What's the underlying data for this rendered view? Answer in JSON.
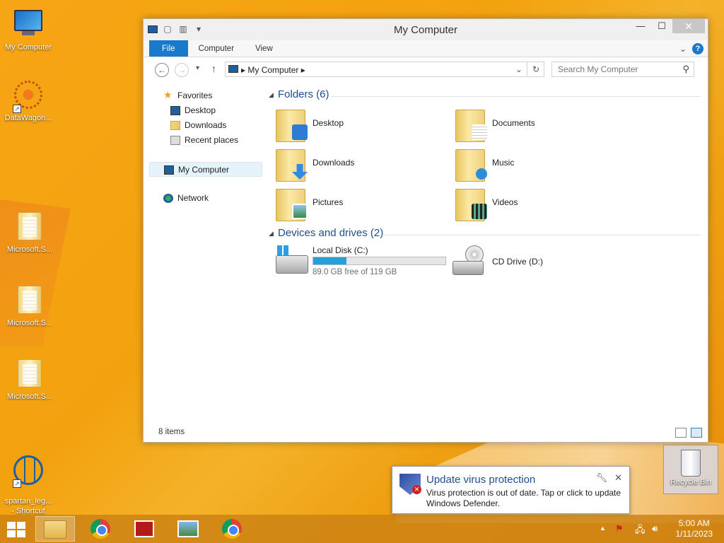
{
  "desktop": {
    "icons": [
      {
        "label": "My Computer"
      },
      {
        "label": "DataWagon..."
      },
      {
        "label": "Microsoft.S..."
      },
      {
        "label": "Microsoft.S..."
      },
      {
        "label": "Microsoft.S..."
      },
      {
        "label": "spartan_leg...\n- Shortcut"
      }
    ],
    "recycle_bin": "Recycle Bin"
  },
  "window": {
    "title": "My Computer",
    "buttons": {
      "minimize": "—",
      "maximize": "☐",
      "close": "✕"
    },
    "ribbon": {
      "file": "File",
      "tabs": [
        "Computer",
        "View"
      ]
    },
    "address": {
      "crumb": "My Computer"
    },
    "search": {
      "placeholder": "Search My Computer"
    },
    "nav": {
      "favorites": "Favorites",
      "fav_items": [
        "Desktop",
        "Downloads",
        "Recent places"
      ],
      "this_pc": "My Computer",
      "network": "Network"
    },
    "folders_header": "Folders (6)",
    "folders": [
      "Desktop",
      "Documents",
      "Downloads",
      "Music",
      "Pictures",
      "Videos"
    ],
    "drives_header": "Devices and drives (2)",
    "drives": [
      {
        "name": "Local Disk (C:)",
        "free_text": "89.0 GB free of 119 GB",
        "used_fraction": 0.252
      },
      {
        "name": "CD Drive (D:)"
      }
    ],
    "status": {
      "count": "8 items"
    }
  },
  "notification": {
    "title": "Update virus protection",
    "message": "Virus protection is out of date. Tap or click to update Windows Defender."
  },
  "taskbar": {
    "time": "5:00 AM",
    "date": "1/11/2023"
  },
  "colors": {
    "accent": "#1979ca",
    "drive_bar": "#26a0da",
    "header_text": "#1e4e8c"
  }
}
